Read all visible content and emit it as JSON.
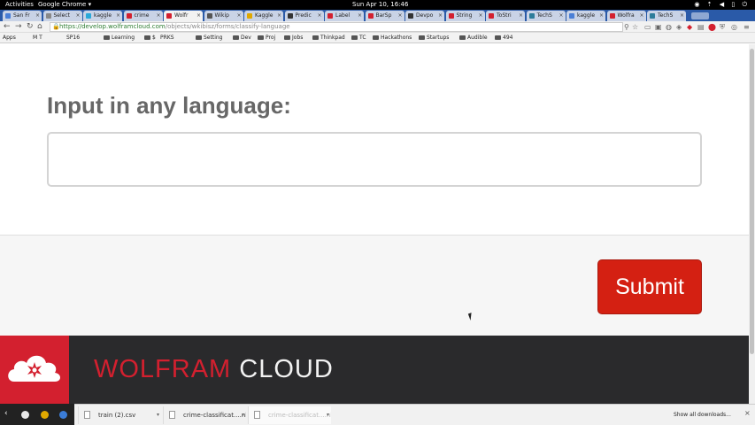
{
  "system_bar": {
    "activities": "Activities",
    "app_menu": "Google Chrome ▾",
    "clock": "Sun Apr 10, 16:46"
  },
  "tabs": [
    {
      "label": "San Fr",
      "fav_color": "#4a7fd6"
    },
    {
      "label": "Select",
      "fav_color": "#888888"
    },
    {
      "label": "kaggle",
      "fav_color": "#2aa8d8"
    },
    {
      "label": "crime",
      "fav_color": "#d3202f"
    },
    {
      "label": "Wolfr",
      "fav_color": "#d3202f",
      "active": true
    },
    {
      "label": "Wikip",
      "fav_color": "#555555"
    },
    {
      "label": "Kaggle",
      "fav_color": "#e0a800"
    },
    {
      "label": "Predic",
      "fav_color": "#333333"
    },
    {
      "label": "Label",
      "fav_color": "#d3202f"
    },
    {
      "label": "BarSp",
      "fav_color": "#d3202f"
    },
    {
      "label": "Devpo",
      "fav_color": "#333333"
    },
    {
      "label": "String",
      "fav_color": "#d3202f"
    },
    {
      "label": "ToStri",
      "fav_color": "#d3202f"
    },
    {
      "label": "TechS",
      "fav_color": "#2e7d9a"
    },
    {
      "label": "kaggle",
      "fav_color": "#4a7fd6"
    },
    {
      "label": "Wolfra",
      "fav_color": "#d3202f"
    },
    {
      "label": "TechS",
      "fav_color": "#2e7d9a"
    }
  ],
  "address_bar": {
    "host": "https://develop.wolframcloud.com",
    "path": "/objects/wkibisz/forms/classify-language"
  },
  "bookmarks": [
    {
      "label": "Apps",
      "folder": false
    },
    {
      "label": "M T",
      "folder": false
    },
    {
      "label": "SP16",
      "folder": false
    },
    {
      "label": "Learning",
      "folder": true
    },
    {
      "label": "$",
      "folder": true
    },
    {
      "label": "PRKS",
      "folder": false
    },
    {
      "label": "Setting",
      "folder": true
    },
    {
      "label": "Dev",
      "folder": true
    },
    {
      "label": "Proj",
      "folder": true
    },
    {
      "label": "Jobs",
      "folder": true
    },
    {
      "label": "Thinkpad",
      "folder": true
    },
    {
      "label": "TC",
      "folder": true
    },
    {
      "label": "Hackathons",
      "folder": true
    },
    {
      "label": "Startups",
      "folder": true
    },
    {
      "label": "Audible",
      "folder": true
    },
    {
      "label": "494",
      "folder": true
    }
  ],
  "form": {
    "label": "Input in any language:",
    "input_value": "",
    "submit_label": "Submit"
  },
  "footer": {
    "brand_word1": "WOLFRAM",
    "brand_word2": " CLOUD",
    "brand_red": "#d3202f"
  },
  "downloads": {
    "items": [
      {
        "label": "train (2).csv"
      },
      {
        "label": "crime-classificat....nb"
      },
      {
        "label": "crime-classificat....nb",
        "faded": true
      }
    ],
    "show_all": "Show all downloads..."
  }
}
